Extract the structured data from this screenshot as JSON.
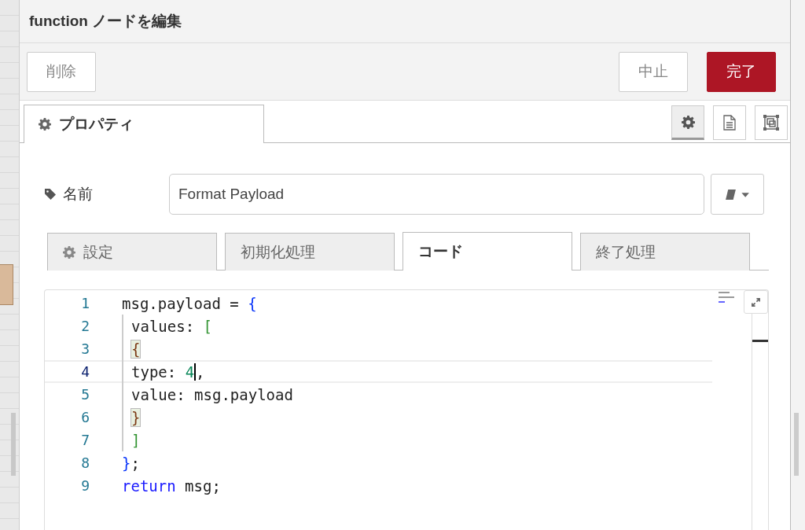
{
  "dialog": {
    "title": "function ノードを編集"
  },
  "actions": [
    {
      "label": "削除",
      "kind": "secondary"
    },
    {
      "label": "中止",
      "kind": "secondary"
    },
    {
      "label": "完了",
      "kind": "primary"
    }
  ],
  "main_tabs": [
    {
      "label": "プロパティ",
      "selected": true
    }
  ],
  "panel_buttons": [
    {
      "kind": "gear",
      "selected": true
    },
    {
      "kind": "document",
      "selected": false
    },
    {
      "kind": "frame",
      "selected": false
    }
  ],
  "name_field": {
    "label": "名前",
    "value": "Format Payload"
  },
  "sub_tabs": [
    {
      "label": "設定",
      "icon": true,
      "selected": false
    },
    {
      "label": "初期化処理",
      "icon": false,
      "selected": false
    },
    {
      "label": "コード",
      "icon": false,
      "selected": true
    },
    {
      "label": "終了処理",
      "icon": false,
      "selected": false
    }
  ],
  "code_lines": [
    {
      "number": "1",
      "indented": false,
      "active": false,
      "segments": [
        {
          "text": "msg.payload = ",
          "kind": "plain"
        },
        {
          "text": "{",
          "kind": "bracket1"
        }
      ]
    },
    {
      "number": "2",
      "indented": true,
      "active": false,
      "segments": [
        {
          "text": "values: ",
          "kind": "plain"
        },
        {
          "text": "[",
          "kind": "bracket2"
        }
      ]
    },
    {
      "number": "3",
      "indented": true,
      "active": false,
      "segments": [
        {
          "text": "{",
          "kind": "bracket3",
          "matched": true
        }
      ]
    },
    {
      "number": "4",
      "indented": true,
      "active": true,
      "segments": [
        {
          "text": "type: ",
          "kind": "plain"
        },
        {
          "text": "4",
          "kind": "number",
          "caret": true
        },
        {
          "text": ",",
          "kind": "plain"
        }
      ]
    },
    {
      "number": "5",
      "indented": true,
      "active": false,
      "segments": [
        {
          "text": "value: msg.payload",
          "kind": "plain"
        }
      ]
    },
    {
      "number": "6",
      "indented": true,
      "active": false,
      "segments": [
        {
          "text": "}",
          "kind": "bracket3",
          "matched": true
        }
      ]
    },
    {
      "number": "7",
      "indented": true,
      "active": false,
      "segments": [
        {
          "text": "]",
          "kind": "bracket2"
        }
      ]
    },
    {
      "number": "8",
      "indented": false,
      "active": false,
      "segments": [
        {
          "text": "}",
          "kind": "bracket1"
        },
        {
          "text": ";",
          "kind": "plain"
        }
      ]
    },
    {
      "number": "9",
      "indented": false,
      "active": false,
      "segments": [
        {
          "text": "return",
          "kind": "keyword"
        },
        {
          "text": " msg;",
          "kind": "plain"
        }
      ]
    }
  ]
}
